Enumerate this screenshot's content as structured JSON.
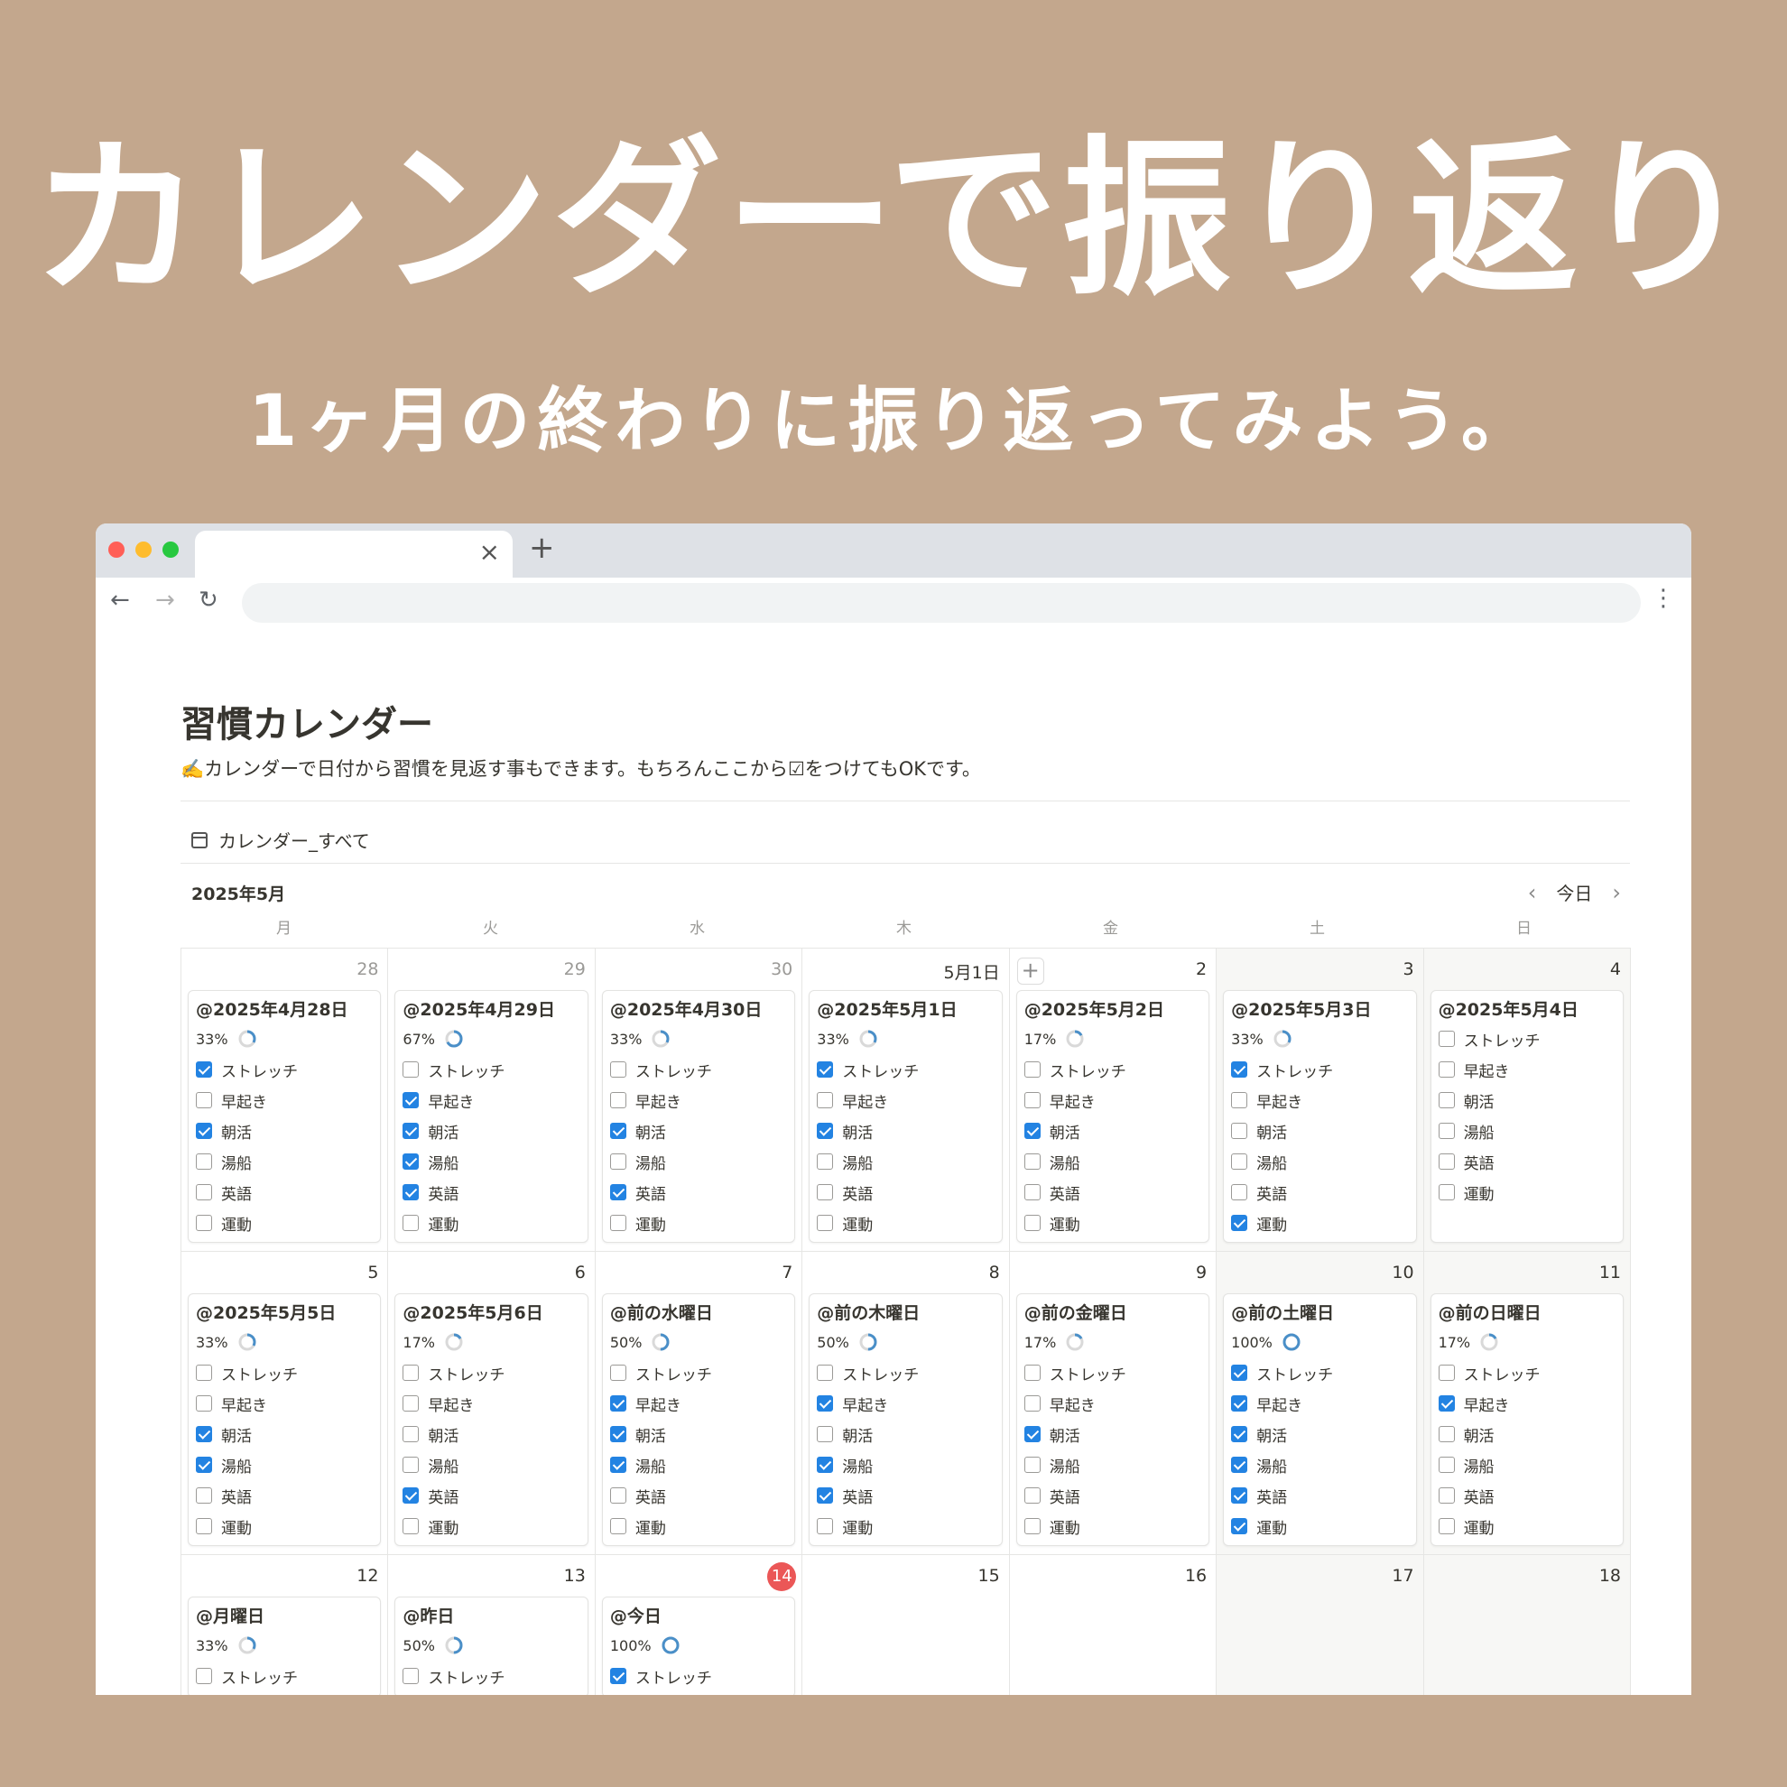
{
  "headline": "カレンダーで振り返り",
  "subline": "1ヶ月の終わりに振り返ってみよう。",
  "browser": {
    "traffic_lights": [
      "#ff5f57",
      "#febc2e",
      "#28c840"
    ],
    "tab_close": "×",
    "new_tab": "+"
  },
  "page": {
    "title": "習慣カレンダー",
    "description": "✍️カレンダーで日付から習慣を見返す事もできます。もちろんここから☑をつけてもOKです。",
    "view_label": "カレンダー_すべて",
    "month_label": "2025年5月",
    "today_label": "今日",
    "weekdays": [
      "月",
      "火",
      "水",
      "木",
      "金",
      "土",
      "日"
    ]
  },
  "colors": {
    "background": "#c3a78d",
    "checkbox_on": "#2383e2",
    "ring_progress": "#4a8fc8",
    "ring_track": "#d9d9d9",
    "today_badge": "#eb5757"
  },
  "habit_names": [
    "ストレッチ",
    "早起き",
    "朝活",
    "湯船",
    "英語",
    "運動"
  ],
  "calendar": {
    "days": [
      {
        "day": "28",
        "muted": true,
        "weekend": false,
        "card": {
          "title": "@2025年4月28日",
          "percent": "33%",
          "progress": 0.33,
          "checks": [
            true,
            false,
            true,
            false,
            false,
            false
          ]
        }
      },
      {
        "day": "29",
        "muted": true,
        "weekend": false,
        "card": {
          "title": "@2025年4月29日",
          "percent": "67%",
          "progress": 0.67,
          "checks": [
            false,
            true,
            true,
            true,
            true,
            false
          ]
        }
      },
      {
        "day": "30",
        "muted": true,
        "weekend": false,
        "card": {
          "title": "@2025年4月30日",
          "percent": "33%",
          "progress": 0.33,
          "checks": [
            false,
            false,
            true,
            false,
            true,
            false
          ]
        }
      },
      {
        "day": "5月1日",
        "muted": false,
        "weekend": false,
        "card": {
          "title": "@2025年5月1日",
          "percent": "33%",
          "progress": 0.33,
          "checks": [
            true,
            false,
            true,
            false,
            false,
            false
          ]
        }
      },
      {
        "day": "2",
        "muted": false,
        "weekend": false,
        "add": "+",
        "card": {
          "title": "@2025年5月2日",
          "percent": "17%",
          "progress": 0.17,
          "checks": [
            false,
            false,
            true,
            false,
            false,
            false
          ]
        }
      },
      {
        "day": "3",
        "muted": false,
        "weekend": true,
        "card": {
          "title": "@2025年5月3日",
          "percent": "33%",
          "progress": 0.33,
          "checks": [
            true,
            false,
            false,
            false,
            false,
            true
          ]
        }
      },
      {
        "day": "4",
        "muted": false,
        "weekend": true,
        "card": {
          "title": "@2025年5月4日",
          "checks": [
            false,
            false,
            false,
            false,
            false,
            false
          ]
        }
      },
      {
        "day": "5",
        "muted": false,
        "weekend": false,
        "card": {
          "title": "@2025年5月5日",
          "percent": "33%",
          "progress": 0.33,
          "checks": [
            false,
            false,
            true,
            true,
            false,
            false
          ]
        }
      },
      {
        "day": "6",
        "muted": false,
        "weekend": false,
        "card": {
          "title": "@2025年5月6日",
          "percent": "17%",
          "progress": 0.17,
          "checks": [
            false,
            false,
            false,
            false,
            true,
            false
          ]
        }
      },
      {
        "day": "7",
        "muted": false,
        "weekend": false,
        "card": {
          "title": "@前の水曜日",
          "percent": "50%",
          "progress": 0.5,
          "checks": [
            false,
            true,
            true,
            true,
            false,
            false
          ]
        }
      },
      {
        "day": "8",
        "muted": false,
        "weekend": false,
        "card": {
          "title": "@前の木曜日",
          "percent": "50%",
          "progress": 0.5,
          "checks": [
            false,
            true,
            false,
            true,
            true,
            false
          ]
        }
      },
      {
        "day": "9",
        "muted": false,
        "weekend": false,
        "card": {
          "title": "@前の金曜日",
          "percent": "17%",
          "progress": 0.17,
          "checks": [
            false,
            false,
            true,
            false,
            false,
            false
          ]
        }
      },
      {
        "day": "10",
        "muted": false,
        "weekend": true,
        "card": {
          "title": "@前の土曜日",
          "percent": "100%",
          "progress": 1.0,
          "checks": [
            true,
            true,
            true,
            true,
            true,
            true
          ]
        }
      },
      {
        "day": "11",
        "muted": false,
        "weekend": true,
        "card": {
          "title": "@前の日曜日",
          "percent": "17%",
          "progress": 0.17,
          "checks": [
            false,
            true,
            false,
            false,
            false,
            false
          ]
        }
      },
      {
        "day": "12",
        "muted": false,
        "weekend": false,
        "card": {
          "title": "@月曜日",
          "percent": "33%",
          "progress": 0.33,
          "checks": [
            false
          ]
        }
      },
      {
        "day": "13",
        "muted": false,
        "weekend": false,
        "card": {
          "title": "@昨日",
          "percent": "50%",
          "progress": 0.5,
          "checks": [
            false
          ]
        }
      },
      {
        "day": "14",
        "muted": false,
        "weekend": false,
        "today": true,
        "card": {
          "title": "@今日",
          "percent": "100%",
          "progress": 1.0,
          "checks": [
            true
          ]
        }
      },
      {
        "day": "15",
        "muted": false,
        "weekend": false
      },
      {
        "day": "16",
        "muted": false,
        "weekend": false
      },
      {
        "day": "17",
        "muted": false,
        "weekend": true
      },
      {
        "day": "18",
        "muted": false,
        "weekend": true
      }
    ]
  }
}
